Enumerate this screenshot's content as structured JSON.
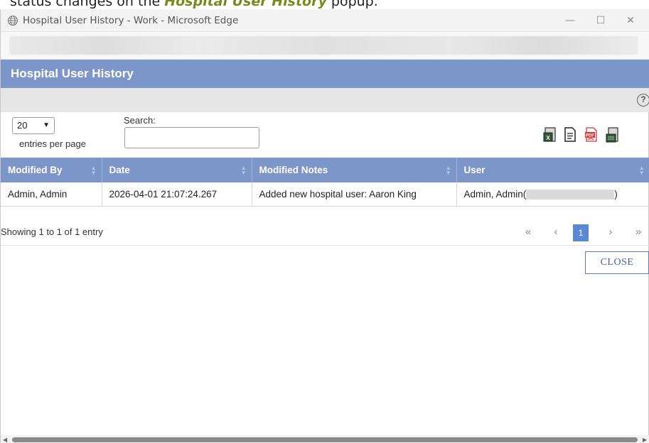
{
  "caption": {
    "prefix": "status changes on the ",
    "highlight": "Hospital User History",
    "suffix": " popup."
  },
  "window": {
    "title": "Hospital User History - Work - Microsoft Edge",
    "min": "—",
    "max": "☐",
    "close": "✕"
  },
  "popup": {
    "title": "Hospital User History",
    "help_glyph": "?"
  },
  "controls": {
    "page_size": "20",
    "per_page_label": "entries per page",
    "search_label": "Search:",
    "search_value": "",
    "exports": [
      "excel-export",
      "copy-export",
      "pdf-export",
      "csv-export"
    ]
  },
  "table": {
    "headers": [
      "Modified By",
      "Date",
      "Modified Notes",
      "User"
    ],
    "rows": [
      {
        "modified_by": "Admin, Admin",
        "date": "2026-04-01 21:07:24.267",
        "notes": "Added new hospital user: Aaron King",
        "user_prefix": "Admin, Admin(",
        "user_suffix": ")"
      }
    ]
  },
  "footer": {
    "showing": "Showing 1 to 1 of 1 entry",
    "pager": {
      "first": "«",
      "prev": "‹",
      "current": "1",
      "next": "›",
      "last": "»"
    }
  },
  "close_button": "CLOSE",
  "colors": {
    "header_blue": "#7c96c9",
    "page_active": "#5b88d3",
    "close_border": "#5c7ab6"
  }
}
